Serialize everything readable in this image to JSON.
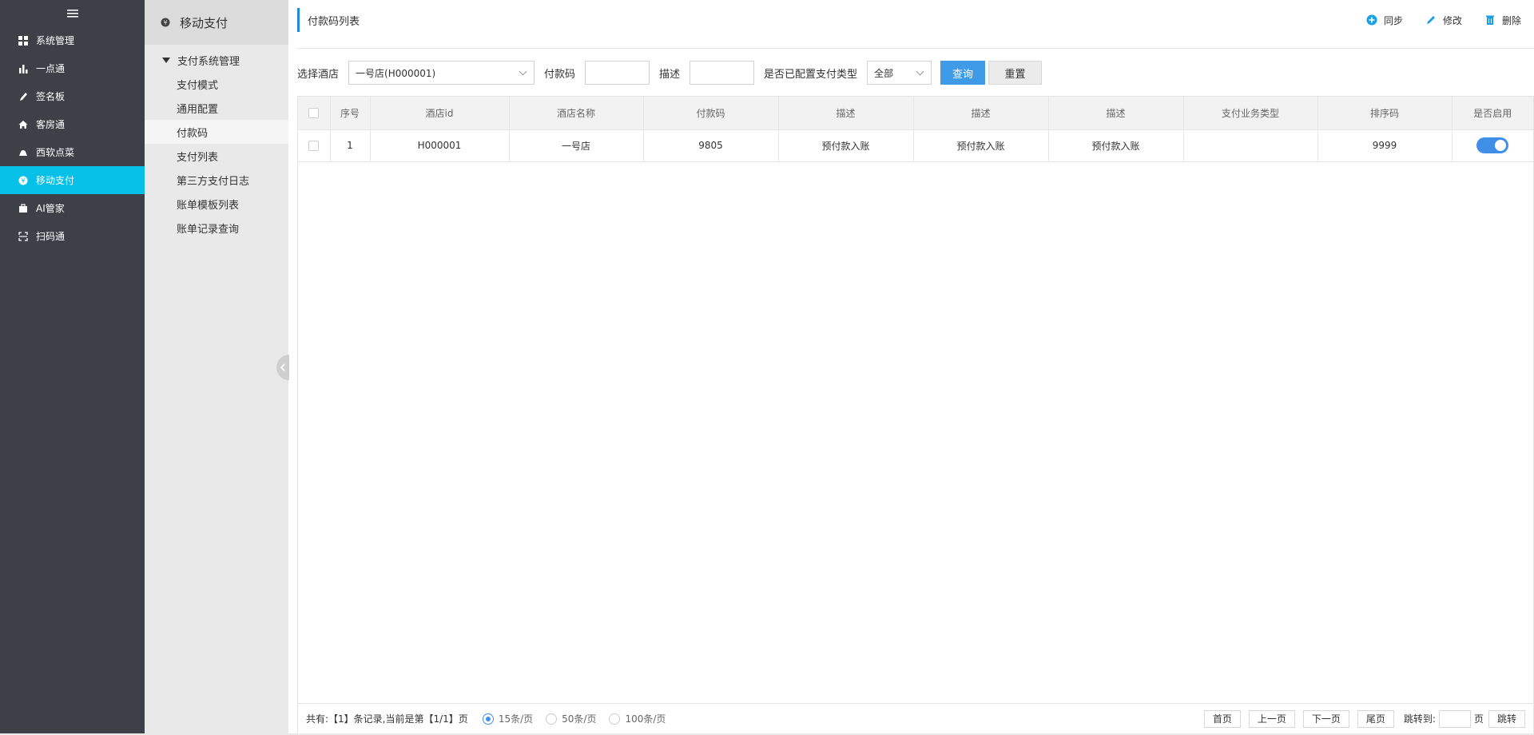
{
  "nav": {
    "items": [
      {
        "label": "系统管理",
        "icon": "grid-icon",
        "active": false
      },
      {
        "label": "一点通",
        "icon": "bar-chart-icon",
        "active": false
      },
      {
        "label": "签名板",
        "icon": "pen-icon",
        "active": false
      },
      {
        "label": "客房通",
        "icon": "home-icon",
        "active": false
      },
      {
        "label": "西软点菜",
        "icon": "cloud-icon",
        "active": false
      },
      {
        "label": "移动支付",
        "icon": "payment-icon",
        "active": true
      },
      {
        "label": "AI管家",
        "icon": "briefcase-icon",
        "active": false
      },
      {
        "label": "扫码通",
        "icon": "scan-icon",
        "active": false
      }
    ]
  },
  "subnav": {
    "header": "移动支付",
    "group": "支付系统管理",
    "items": [
      "支付模式",
      "通用配置",
      "付款码",
      "支付列表",
      "第三方支付日志",
      "账单模板列表",
      "账单记录查询"
    ],
    "active_index": 2
  },
  "main": {
    "title": "付款码列表",
    "actions": {
      "sync": "同步",
      "edit": "修改",
      "delete": "删除"
    },
    "filters": {
      "hotel_label": "选择酒店",
      "hotel_value": "一号店(H000001)",
      "code_label": "付款码",
      "code_value": "",
      "desc_label": "描述",
      "desc_value": "",
      "config_label": "是否已配置支付类型",
      "config_value": "全部",
      "query_button": "查询",
      "reset_button": "重置"
    },
    "table": {
      "headers": [
        "序号",
        "酒店id",
        "酒店名称",
        "付款码",
        "描述",
        "描述",
        "描述",
        "支付业务类型",
        "排序码",
        "是否启用"
      ],
      "rows": [
        {
          "index": "1",
          "hotel_id": "H000001",
          "hotel_name": "一号店",
          "code": "9805",
          "desc1": "预付款入账",
          "desc2": "预付款入账",
          "desc3": "预付款入账",
          "biz_type": "",
          "sort": "9999",
          "enabled": true
        }
      ]
    },
    "pager": {
      "summary": "共有:【1】条记录,当前是第【1/1】页",
      "sizes": [
        "15条/页",
        "50条/页",
        "100条/页"
      ],
      "selected_size": "15条/页",
      "first": "首页",
      "prev": "上一页",
      "next": "下一页",
      "last": "尾页",
      "jump_label": "跳转到:",
      "page_unit": "页",
      "jump_button": "跳转"
    }
  },
  "colors": {
    "nav_bg": "#3e4048",
    "nav_active": "#07c0e8",
    "primary": "#3f9be8",
    "accent_bar": "#1f8ad7"
  }
}
